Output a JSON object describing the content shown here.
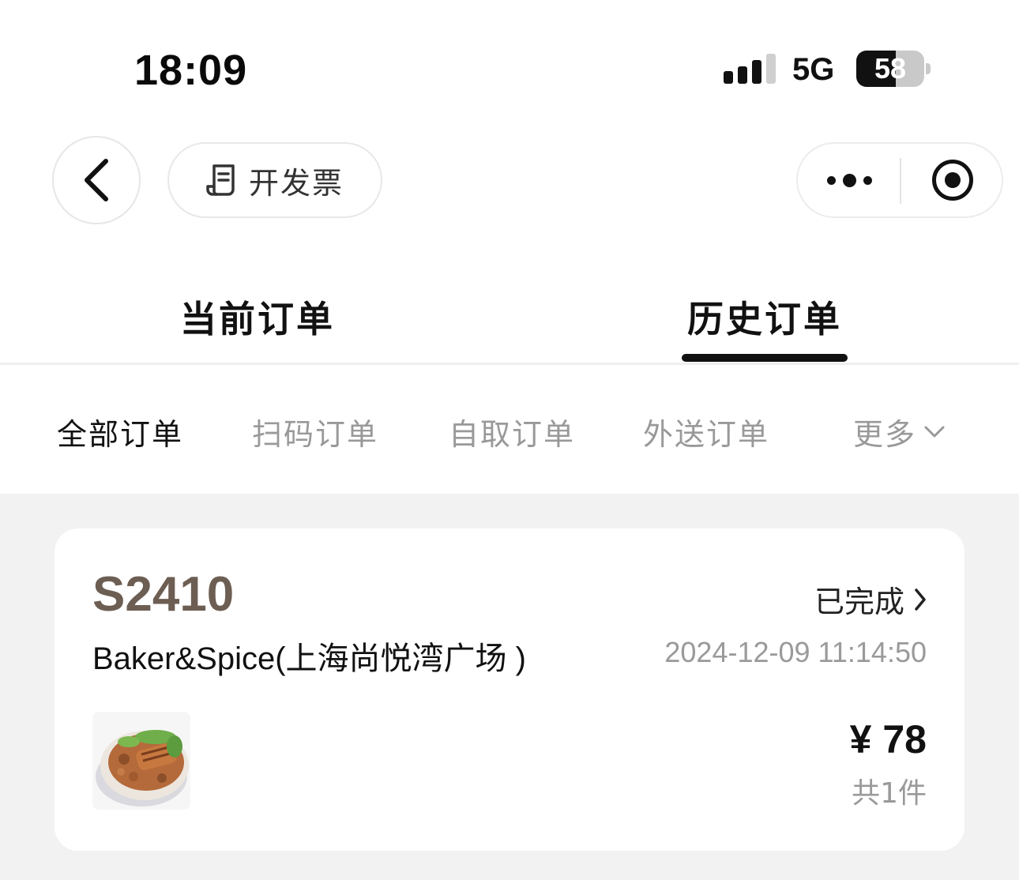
{
  "status_bar": {
    "time": "18:09",
    "network": "5G",
    "battery": "58",
    "battery_level_percent": 58
  },
  "nav": {
    "back_icon": "chevron-left-icon",
    "invoice_icon": "receipt-icon",
    "invoice_label": "开发票",
    "more_icon": "more-dots-icon",
    "close_icon": "target-icon"
  },
  "main_tabs": [
    {
      "label": "当前订单",
      "active": false
    },
    {
      "label": "历史订单",
      "active": true
    }
  ],
  "sub_tabs": [
    {
      "label": "全部订单",
      "active": true
    },
    {
      "label": "扫码订单",
      "active": false
    },
    {
      "label": "自取订单",
      "active": false
    },
    {
      "label": "外送订单",
      "active": false
    }
  ],
  "sub_more_label": "更多",
  "orders": [
    {
      "order_no": "S2410",
      "status": "已完成",
      "store": "Baker&Spice(上海尚悦湾广场 )",
      "datetime": "2024-12-09 11:14:50",
      "price": "¥ 78",
      "quantity": "共1件"
    }
  ],
  "colors": {
    "order_no": "#6d5e53",
    "background": "#f2f2f2",
    "muted_text": "#999999"
  }
}
